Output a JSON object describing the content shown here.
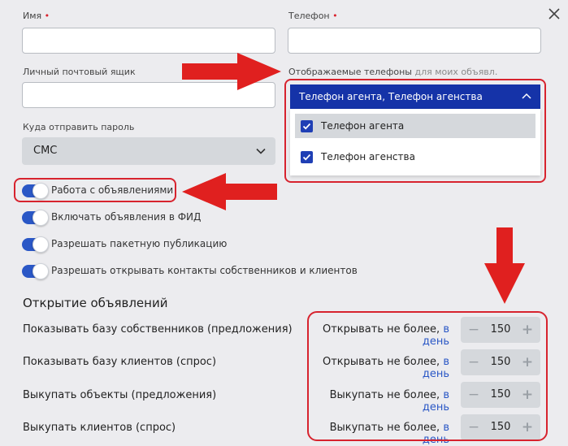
{
  "form": {
    "name_label": "Имя",
    "phone_label": "Телефон",
    "required_mark": "•",
    "email_label": "Личный почтовый ящик",
    "display_phones_label": "Отображаемые телефоны",
    "display_phones_hint": "для моих объявл.",
    "password_dest_label": "Куда отправить пароль",
    "password_dest_value": "СМС"
  },
  "phones_dropdown": {
    "selected_text": "Телефон агента, Телефон агенства",
    "options": [
      {
        "label": "Телефон агента",
        "checked": true
      },
      {
        "label": "Телефон агенства",
        "checked": true
      }
    ]
  },
  "toggles": [
    {
      "label": "Работа с объявлениями",
      "on": true
    },
    {
      "label": "Включать объявления в ФИД",
      "on": true
    },
    {
      "label": "Разрешать пакетную публикацию",
      "on": true
    },
    {
      "label": "Разрешать открывать контакты собственников и клиентов",
      "on": true
    }
  ],
  "listings_section": {
    "title": "Открытие объявлений",
    "rows": [
      {
        "label": "Показывать базу собственников (предложения)",
        "limit_text": "Открывать не более,",
        "period": "в день",
        "value": "150"
      },
      {
        "label": "Показывать базу клиентов (спрос)",
        "limit_text": "Открывать не более,",
        "period": "в день",
        "value": "150"
      },
      {
        "label": "Выкупать объекты (предложения)",
        "limit_text": "Выкупать не более,",
        "period": "в день",
        "value": "150"
      },
      {
        "label": "Выкупать клиентов (спрос)",
        "limit_text": "Выкупать не более,",
        "period": "в день",
        "value": "150"
      }
    ]
  },
  "stepper_symbols": {
    "minus": "−",
    "plus": "+"
  },
  "colors": {
    "accent": "#2a57c6",
    "dropdown_header": "#1533a8",
    "annotation_red": "#d7232e",
    "background": "#ececef"
  }
}
